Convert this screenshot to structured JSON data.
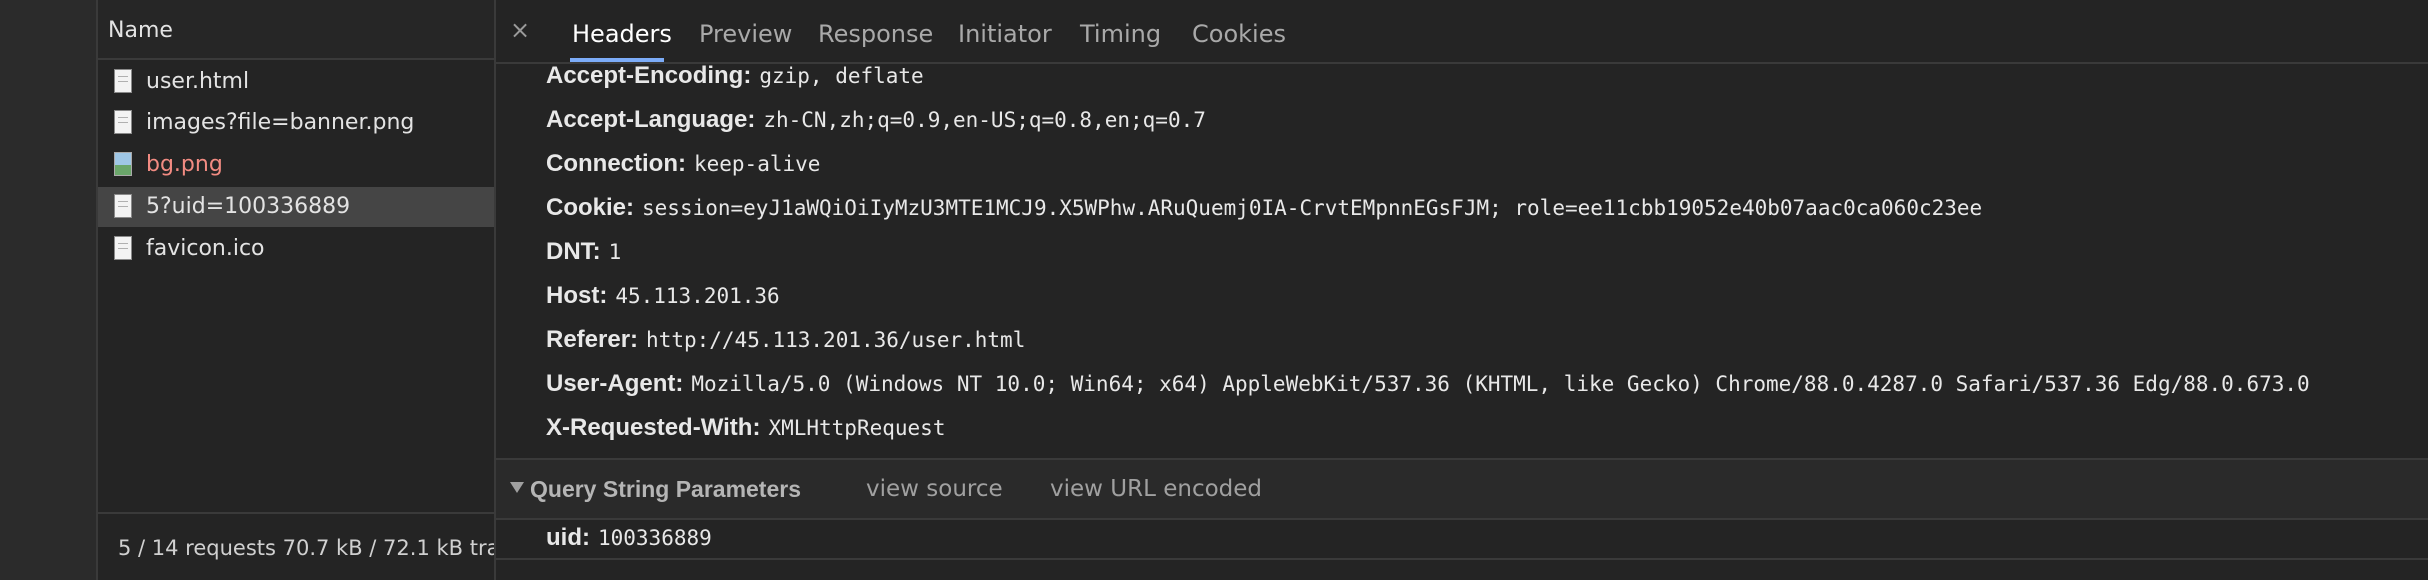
{
  "request_list": {
    "column_name": "Name",
    "items": [
      {
        "label": "user.html",
        "icon": "document-icon",
        "error": false,
        "selected": false
      },
      {
        "label": "images?file=banner.png",
        "icon": "document-icon",
        "error": false,
        "selected": false
      },
      {
        "label": "bg.png",
        "icon": "image-icon",
        "error": true,
        "selected": false
      },
      {
        "label": "5?uid=100336889",
        "icon": "document-icon",
        "error": false,
        "selected": true
      },
      {
        "label": "favicon.ico",
        "icon": "document-icon",
        "error": false,
        "selected": false
      }
    ],
    "footer": "5 / 14 requests  70.7 kB / 72.1 kB tra"
  },
  "details": {
    "close_symbol": "×",
    "tabs": [
      {
        "label": "Headers",
        "active": true
      },
      {
        "label": "Preview",
        "active": false
      },
      {
        "label": "Response",
        "active": false
      },
      {
        "label": "Initiator",
        "active": false
      },
      {
        "label": "Timing",
        "active": false
      },
      {
        "label": "Cookies",
        "active": false
      }
    ],
    "request_headers": [
      {
        "key": "Accept-Encoding:",
        "value": "gzip, deflate"
      },
      {
        "key": "Accept-Language:",
        "value": "zh-CN,zh;q=0.9,en-US;q=0.8,en;q=0.7"
      },
      {
        "key": "Connection:",
        "value": "keep-alive"
      },
      {
        "key": "Cookie:",
        "value": "session=eyJ1aWQiOiIyMzU3MTE1MCJ9.X5WPhw.ARuQuemj0IA-CrvtEMpnnEGsFJM; role=ee11cbb19052e40b07aac0ca060c23ee"
      },
      {
        "key": "DNT:",
        "value": "1"
      },
      {
        "key": "Host:",
        "value": "45.113.201.36"
      },
      {
        "key": "Referer:",
        "value": "http://45.113.201.36/user.html"
      },
      {
        "key": "User-Agent:",
        "value": "Mozilla/5.0 (Windows NT 10.0; Win64; x64) AppleWebKit/537.36 (KHTML, like Gecko) Chrome/88.0.4287.0 Safari/537.36 Edg/88.0.673.0"
      },
      {
        "key": "X-Requested-With:",
        "value": "XMLHttpRequest"
      }
    ],
    "query_section": {
      "title": "Query String Parameters",
      "view_source": "view source",
      "view_url_encoded": "view URL encoded",
      "params": [
        {
          "key": "uid:",
          "value": "100336889"
        }
      ]
    }
  },
  "colors": {
    "background": "#242424",
    "active_tab_underline": "#7cacf8",
    "error_text": "#f28b82",
    "selected_row": "#454545"
  }
}
